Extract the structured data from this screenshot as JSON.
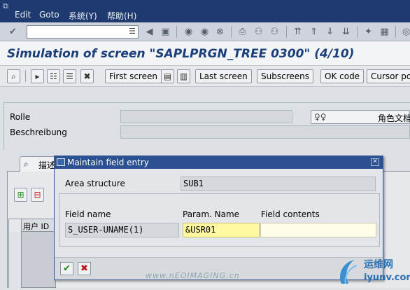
{
  "menubar": {
    "items": [
      "Edit",
      "Goto",
      "系统(Y)",
      "帮助(H)"
    ]
  },
  "command_field": {
    "value": ""
  },
  "title": "Simulation of screen \"SAPLPRGN_TREE 0300\" (4/10)",
  "app_toolbar": {
    "first_screen": "First screen",
    "last_screen": "Last screen",
    "subscreens": "Subscreens",
    "ok_code": "OK code",
    "cursor_pos": "Cursor pos"
  },
  "form": {
    "rolle_label": "Rolle",
    "rolle_value": "",
    "beschreibung_label": "Beschreibung",
    "beschreibung_value": "",
    "role_doc_button": "角色文档"
  },
  "tab": {
    "label": "描述"
  },
  "grid": {
    "header_label": "用户 ID"
  },
  "popup": {
    "title": "Maintain field entry",
    "area_structure_label": "Area structure",
    "area_structure_value": "SUB1",
    "col_field_name": "Field name",
    "col_param_name": "Param. Name",
    "col_field_contents": "Field contents",
    "field_name_value": "S_USER-UNAME(1)",
    "param_name_value": "&USR01",
    "field_contents_value": ""
  },
  "watermark": "www.nEOIMAGING.cn",
  "logo": {
    "name": "运维网",
    "url": "iyunv.com"
  },
  "colors": {
    "menubar": "#1f3a6e",
    "title_text": "#1b3f7a",
    "popup_titlebar": "#2b5192",
    "param_highlight": "#fff8a0",
    "contents_field": "#fffde8",
    "ok_green": "#1d8a1d",
    "cancel_red": "#c0161c"
  },
  "icons": {
    "menubar": [
      "system-menu-icon"
    ],
    "toolbar": [
      "enter-check-icon",
      "back-arrow-icon",
      "save-icon",
      "back-nav-icon",
      "exit-nav-icon",
      "cancel-nav-icon",
      "print-icon",
      "find-icon",
      "find-next-icon",
      "first-page-icon",
      "prev-page-icon",
      "next-page-icon",
      "last-page-icon",
      "new-session-icon",
      "shortcut-icon",
      "help-icon"
    ],
    "app_toolbar": [
      "display-icon",
      "navigate-icon",
      "hierarchy-icon",
      "tree-icon",
      "delete-icon",
      "screen-a-icon",
      "screen-b-icon"
    ]
  }
}
